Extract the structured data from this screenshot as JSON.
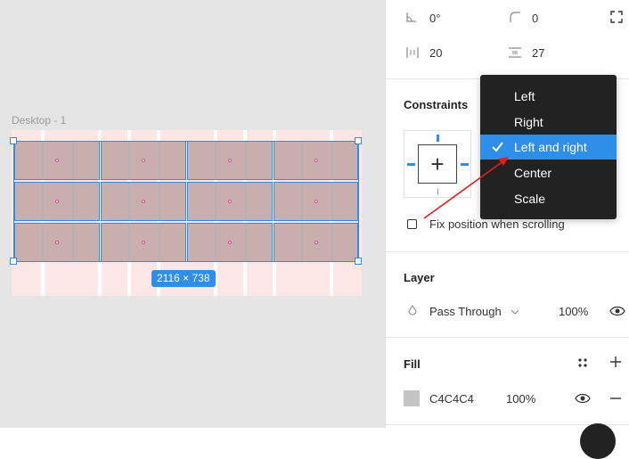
{
  "canvas": {
    "frame_label": "Desktop - 1",
    "size_badge": "2116 × 738"
  },
  "transform": {
    "rotation": "0°",
    "corner_radius": "0",
    "horizontal_spacing": "20",
    "vertical_spacing": "27"
  },
  "constraints": {
    "title": "Constraints",
    "fix_position_label": "Fix position when scrolling",
    "fix_position_checked": false,
    "dropdown": {
      "options": [
        "Left",
        "Right",
        "Left and right",
        "Center",
        "Scale"
      ],
      "selected": "Left and right"
    }
  },
  "layer": {
    "title": "Layer",
    "blend_mode": "Pass Through",
    "opacity": "100%"
  },
  "fill": {
    "title": "Fill",
    "color_hex": "C4C4C4",
    "opacity": "100%"
  },
  "icons": {
    "rotation": "angle-icon",
    "corner_radius": "corner-radius-icon",
    "independent_corners": "expand-corners-icon",
    "h_spacing": "horizontal-spacing-icon",
    "v_spacing": "vertical-spacing-icon",
    "blend": "drop-icon",
    "chevron": "chevron-down-icon",
    "eye": "eye-icon",
    "styles": "style-grid-icon",
    "add": "plus-icon",
    "remove": "minus-icon",
    "check": "checkmark-icon"
  },
  "colors": {
    "accent": "#2f8ee8",
    "dropdown_bg": "#222222",
    "annotation": "#e0201c",
    "frame_bg": "#fde6e6",
    "grid_cell": "#c9aeae"
  }
}
